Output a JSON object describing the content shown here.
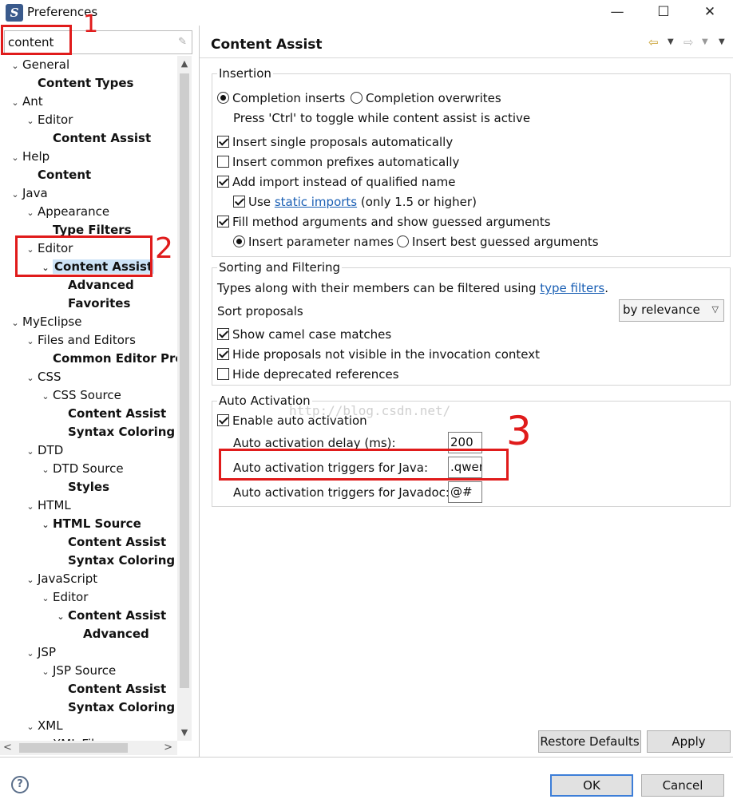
{
  "window": {
    "title": "Preferences",
    "app_icon": "eclipse-icon",
    "minimize": "—",
    "maximize": "☐",
    "close": "✕"
  },
  "filter": {
    "value": "content",
    "clear_icon": "eraser-icon"
  },
  "tree": {
    "items": [
      {
        "label": "General",
        "twisty": "v",
        "bold": false
      },
      {
        "label": "Content Types",
        "twisty": "",
        "bold": true
      },
      {
        "label": "Ant",
        "twisty": "v",
        "bold": false
      },
      {
        "label": "Editor",
        "twisty": "v",
        "bold": false
      },
      {
        "label": "Content Assist",
        "twisty": "",
        "bold": true
      },
      {
        "label": "Help",
        "twisty": "v",
        "bold": false
      },
      {
        "label": "Content",
        "twisty": "",
        "bold": true
      },
      {
        "label": "Java",
        "twisty": "v",
        "bold": false
      },
      {
        "label": "Appearance",
        "twisty": "v",
        "bold": false
      },
      {
        "label": "Type Filters",
        "twisty": "",
        "bold": true
      },
      {
        "label": "Editor",
        "twisty": "v",
        "bold": false
      },
      {
        "label": "Content Assist",
        "twisty": "v",
        "bold": true,
        "selected": true
      },
      {
        "label": "Advanced",
        "twisty": "",
        "bold": true
      },
      {
        "label": "Favorites",
        "twisty": "",
        "bold": true
      },
      {
        "label": "MyEclipse",
        "twisty": "v",
        "bold": false
      },
      {
        "label": "Files and Editors",
        "twisty": "v",
        "bold": false
      },
      {
        "label": "Common Editor Pref",
        "twisty": "",
        "bold": true
      },
      {
        "label": "CSS",
        "twisty": "v",
        "bold": false
      },
      {
        "label": "CSS Source",
        "twisty": "v",
        "bold": false
      },
      {
        "label": "Content Assist",
        "twisty": "",
        "bold": true
      },
      {
        "label": "Syntax Coloring",
        "twisty": "",
        "bold": true
      },
      {
        "label": "DTD",
        "twisty": "v",
        "bold": false
      },
      {
        "label": "DTD Source",
        "twisty": "v",
        "bold": false
      },
      {
        "label": "Styles",
        "twisty": "",
        "bold": true
      },
      {
        "label": "HTML",
        "twisty": "v",
        "bold": false
      },
      {
        "label": "HTML Source",
        "twisty": "v",
        "bold": true
      },
      {
        "label": "Content Assist",
        "twisty": "",
        "bold": true
      },
      {
        "label": "Syntax Coloring",
        "twisty": "",
        "bold": true
      },
      {
        "label": "JavaScript",
        "twisty": "v",
        "bold": false
      },
      {
        "label": "Editor",
        "twisty": "v",
        "bold": false
      },
      {
        "label": "Content Assist",
        "twisty": "v",
        "bold": true
      },
      {
        "label": "Advanced",
        "twisty": "",
        "bold": true
      },
      {
        "label": "JSP",
        "twisty": "v",
        "bold": false
      },
      {
        "label": "JSP Source",
        "twisty": "v",
        "bold": false
      },
      {
        "label": "Content Assist",
        "twisty": "",
        "bold": true
      },
      {
        "label": "Syntax Coloring",
        "twisty": "",
        "bold": true
      },
      {
        "label": "XML",
        "twisty": "v",
        "bold": false
      },
      {
        "label": "XML Files",
        "twisty": "",
        "bold": false
      }
    ]
  },
  "page": {
    "title": "Content Assist",
    "back_icon": "back-arrow-icon",
    "forward_icon": "forward-arrow-icon",
    "menu_icon": "view-menu-icon"
  },
  "insertion": {
    "title": "Insertion",
    "completion_inserts": "Completion inserts",
    "completion_overwrites": "Completion overwrites",
    "toggle_hint": "Press 'Ctrl' to toggle while content assist is active",
    "insert_single": "Insert single proposals automatically",
    "insert_common": "Insert common prefixes automatically",
    "add_import": "Add import instead of qualified name",
    "use": "Use",
    "static_imports": "static imports",
    "only_15": "(only 1.5 or higher)",
    "fill_args": "Fill method arguments and show guessed arguments",
    "insert_param_names": "Insert parameter names",
    "insert_best_guessed": "Insert best guessed arguments"
  },
  "sorting": {
    "title": "Sorting and Filtering",
    "types_text": "Types along with their members can be filtered using",
    "type_filters": "type filters",
    "period": ".",
    "sort_label": "Sort proposals",
    "sort_value": "by relevance",
    "camel": "Show camel case matches",
    "hide_not_visible": "Hide proposals not visible in the invocation context",
    "hide_deprecated": "Hide deprecated references"
  },
  "auto": {
    "title": "Auto Activation",
    "enable": "Enable auto activation",
    "delay_label": "Auto activation delay (ms):",
    "delay_value": "200",
    "java_label": "Auto activation triggers for Java:",
    "java_value": ".qwer",
    "javadoc_label": "Auto activation triggers for Javadoc:",
    "javadoc_value": "@#"
  },
  "watermark": "http://blog.csdn.net/",
  "buttons": {
    "restore_defaults": "Restore Defaults",
    "apply": "Apply",
    "ok": "OK",
    "cancel": "Cancel",
    "help_icon": "help-icon"
  },
  "annotations": {
    "one": "1",
    "two": "2",
    "three": "3",
    "color": "#e01b1b"
  }
}
